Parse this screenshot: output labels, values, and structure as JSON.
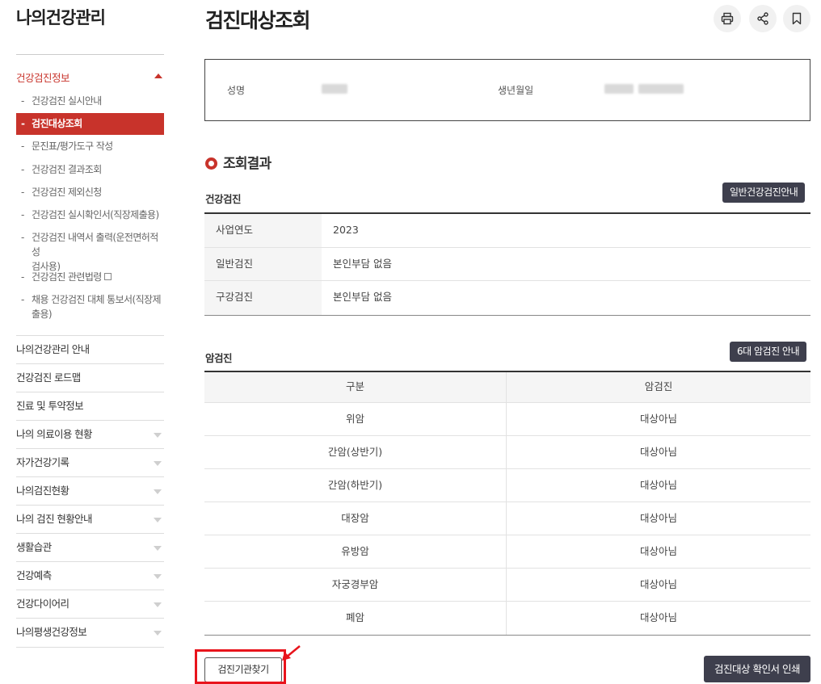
{
  "sidebar": {
    "title": "나의건강관리",
    "section": "건강검진정보",
    "sub_items": [
      {
        "label": "건강검진 실시안내"
      },
      {
        "label": "검진대상조회"
      },
      {
        "label": "문진표/평가도구 작성"
      },
      {
        "label": "건강검진 결과조회"
      },
      {
        "label": "건강검진 제외신청"
      },
      {
        "label": "건강검진 실시확인서(직장제출용)"
      },
      {
        "label": "건강검진 내역서 출력(운전면허적성",
        "label2": "검사용)"
      },
      {
        "label": "건강검진 관련법령"
      },
      {
        "label": "채용 건강검진 대체 통보서(직장제",
        "label2": "출용)"
      }
    ],
    "menu": [
      {
        "label": "나의건강관리 안내"
      },
      {
        "label": "건강검진 로드맵"
      },
      {
        "label": "진료 및 투약정보"
      },
      {
        "label": "나의 의료이용 현황"
      },
      {
        "label": "자가건강기록"
      },
      {
        "label": "나의검진현황"
      },
      {
        "label": "나의 검진 현황안내"
      },
      {
        "label": "생활습관"
      },
      {
        "label": "건강예측"
      },
      {
        "label": "건강다이어리"
      },
      {
        "label": "나의평생건강정보"
      }
    ]
  },
  "header": {
    "title": "검진대상조회",
    "icons": [
      "print-icon",
      "share-icon",
      "bookmark-icon"
    ]
  },
  "info": {
    "name_label": "성명",
    "birth_label": "생년월일"
  },
  "result": {
    "title": "조회결과",
    "general": {
      "label": "건강검진",
      "guide_button": "일반건강검진안내",
      "rows": [
        {
          "head": "사업연도",
          "value": "2023"
        },
        {
          "head": "일반검진",
          "value": "본인부담 없음"
        },
        {
          "head": "구강검진",
          "value": "본인부담 없음"
        }
      ]
    },
    "cancer": {
      "label": "암검진",
      "guide_button": "6대 암검진 안내",
      "columns": [
        "구분",
        "암검진"
      ],
      "rows": [
        {
          "type": "위암",
          "status": "대상아님"
        },
        {
          "type": "간암(상반기)",
          "status": "대상아님"
        },
        {
          "type": "간암(하반기)",
          "status": "대상아님"
        },
        {
          "type": "대장암",
          "status": "대상아님"
        },
        {
          "type": "유방암",
          "status": "대상아님"
        },
        {
          "type": "자궁경부암",
          "status": "대상아님"
        },
        {
          "type": "폐암",
          "status": "대상아님"
        }
      ]
    }
  },
  "actions": {
    "find_button": "검진기관찾기",
    "print_button": "검진대상 확인서 인쇄"
  },
  "colors": {
    "accent": "#c8332b",
    "dark_button": "#3e3f4d",
    "annotation": "#e8141c"
  }
}
